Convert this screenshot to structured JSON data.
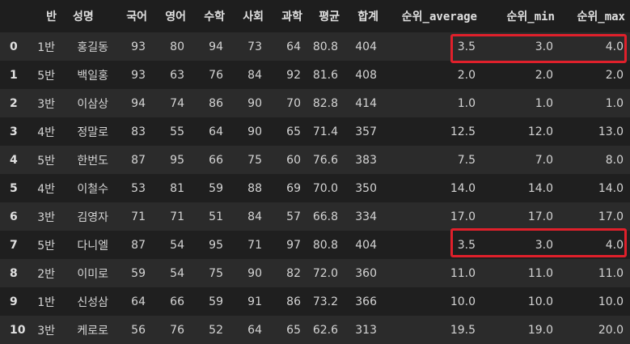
{
  "table": {
    "index_header": "",
    "columns": [
      "반",
      "성명",
      "국어",
      "영어",
      "수학",
      "사회",
      "과학",
      "평균",
      "합계",
      "순위_average",
      "순위_min",
      "순위_max"
    ],
    "rows": [
      {
        "index": "0",
        "cells": [
          "1반",
          "홍길동",
          "93",
          "80",
          "94",
          "73",
          "64",
          "80.8",
          "404",
          "3.5",
          "3.0",
          "4.0"
        ]
      },
      {
        "index": "1",
        "cells": [
          "5반",
          "백일홍",
          "93",
          "63",
          "76",
          "84",
          "92",
          "81.6",
          "408",
          "2.0",
          "2.0",
          "2.0"
        ]
      },
      {
        "index": "2",
        "cells": [
          "3반",
          "이삼상",
          "94",
          "74",
          "86",
          "90",
          "70",
          "82.8",
          "414",
          "1.0",
          "1.0",
          "1.0"
        ]
      },
      {
        "index": "3",
        "cells": [
          "4반",
          "정말로",
          "83",
          "55",
          "64",
          "90",
          "65",
          "71.4",
          "357",
          "12.5",
          "12.0",
          "13.0"
        ]
      },
      {
        "index": "4",
        "cells": [
          "5반",
          "한번도",
          "87",
          "95",
          "66",
          "75",
          "60",
          "76.6",
          "383",
          "7.5",
          "7.0",
          "8.0"
        ]
      },
      {
        "index": "5",
        "cells": [
          "4반",
          "이철수",
          "53",
          "81",
          "59",
          "88",
          "69",
          "70.0",
          "350",
          "14.0",
          "14.0",
          "14.0"
        ]
      },
      {
        "index": "6",
        "cells": [
          "3반",
          "김영자",
          "71",
          "71",
          "51",
          "84",
          "57",
          "66.8",
          "334",
          "17.0",
          "17.0",
          "17.0"
        ]
      },
      {
        "index": "7",
        "cells": [
          "5반",
          "다니엘",
          "87",
          "54",
          "95",
          "71",
          "97",
          "80.8",
          "404",
          "3.5",
          "3.0",
          "4.0"
        ]
      },
      {
        "index": "8",
        "cells": [
          "2반",
          "이미로",
          "59",
          "54",
          "75",
          "90",
          "82",
          "72.0",
          "360",
          "11.0",
          "11.0",
          "11.0"
        ]
      },
      {
        "index": "9",
        "cells": [
          "1반",
          "신성삼",
          "64",
          "66",
          "59",
          "91",
          "86",
          "73.2",
          "366",
          "10.0",
          "10.0",
          "10.0"
        ]
      },
      {
        "index": "10",
        "cells": [
          "3반",
          "케로로",
          "56",
          "76",
          "52",
          "64",
          "65",
          "62.6",
          "313",
          "19.5",
          "19.0",
          "20.0"
        ]
      }
    ]
  },
  "colors": {
    "background": "#1e1e1e",
    "row_odd": "#2b2b2b",
    "row_even": "#1f1f1f",
    "text": "#d4d4d4",
    "highlight": "#e0202b"
  }
}
